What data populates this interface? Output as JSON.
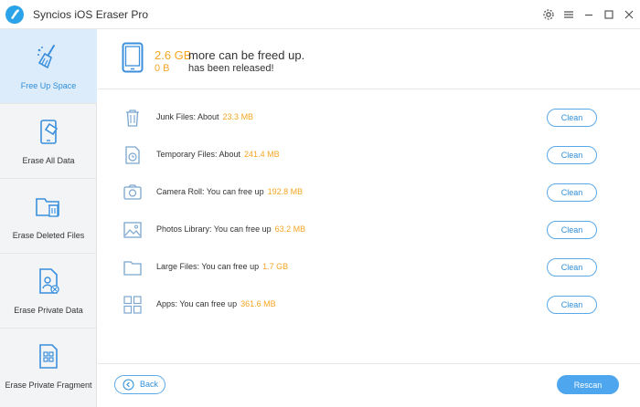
{
  "app": {
    "title": "Syncios iOS Eraser Pro"
  },
  "colors": {
    "accent": "#2f8fd8",
    "highlight": "#f5a623",
    "sidebar_active": "#dcecfa"
  },
  "sidebar": {
    "items": [
      {
        "label": "Free Up Space",
        "icon": "broom-icon",
        "active": true
      },
      {
        "label": "Erase All Data",
        "icon": "phone-eraser-icon",
        "active": false
      },
      {
        "label": "Erase Deleted Files",
        "icon": "folder-trash-icon",
        "active": false
      },
      {
        "label": "Erase Private Data",
        "icon": "private-file-icon",
        "active": false
      },
      {
        "label": "Erase Private Fragment",
        "icon": "fragment-grid-icon",
        "active": false
      }
    ]
  },
  "header": {
    "freed_size": "2.6 GB",
    "freed_text": "more can be freed up.",
    "released_size": "0 B",
    "released_text": "has been released!"
  },
  "rows": [
    {
      "label": "Junk Files: About",
      "size": "23.3 MB",
      "icon": "trash-icon",
      "button": "Clean"
    },
    {
      "label": "Temporary Files: About",
      "size": "241.4 MB",
      "icon": "clock-file-icon",
      "button": "Clean"
    },
    {
      "label": "Camera Roll: You can free up",
      "size": "192.8 MB",
      "icon": "camera-icon",
      "button": "Clean"
    },
    {
      "label": "Photos Library: You can free up",
      "size": "63.2 MB",
      "icon": "image-icon",
      "button": "Clean"
    },
    {
      "label": "Large Files: You can free up",
      "size": "1.7 GB",
      "icon": "folder-icon",
      "button": "Clean"
    },
    {
      "label": "Apps: You can free up",
      "size": "361.6 MB",
      "icon": "apps-grid-icon",
      "button": "Clean"
    }
  ],
  "footer": {
    "back_label": "Back",
    "rescan_label": "Rescan"
  }
}
